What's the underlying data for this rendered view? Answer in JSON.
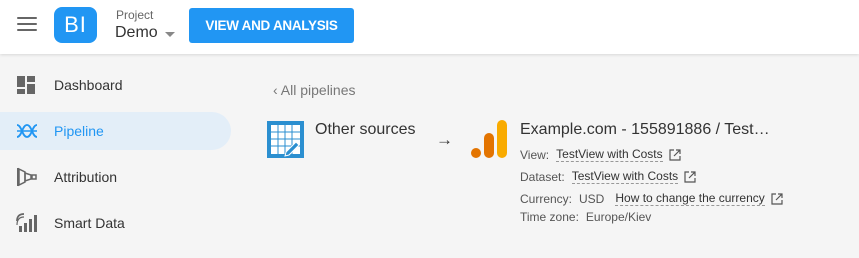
{
  "header": {
    "logo_text": "BI",
    "project_label": "Project",
    "project_name": "Demo",
    "view_button": "VIEW AND ANALYSIS"
  },
  "sidebar": {
    "items": [
      {
        "label": "Dashboard",
        "icon": "dashboard-icon",
        "active": false
      },
      {
        "label": "Pipeline",
        "icon": "pipeline-icon",
        "active": true
      },
      {
        "label": "Attribution",
        "icon": "attribution-icon",
        "active": false
      },
      {
        "label": "Smart Data",
        "icon": "smart-data-icon",
        "active": false
      }
    ]
  },
  "main": {
    "back_link": "‹ All pipelines",
    "source": {
      "label": "Other sources",
      "icon": "other-sources-icon"
    },
    "arrow": "→",
    "destination": {
      "title": "Example.com - 155891886 / Test…",
      "icon": "analytics-icon",
      "view_label": "View:",
      "view_link": "TestView with Costs",
      "dataset_label": "Dataset:",
      "dataset_link": "TestView with Costs",
      "currency_label": "Currency:",
      "currency_value": "USD",
      "currency_link": "How to change the currency",
      "timezone_label": "Time zone:",
      "timezone_value": "Europe/Kiev"
    }
  },
  "colors": {
    "accent": "#2196f3",
    "active_bg": "#e3eef8",
    "analytics_orange": "#f9ab00",
    "analytics_dark_orange": "#e37400"
  }
}
